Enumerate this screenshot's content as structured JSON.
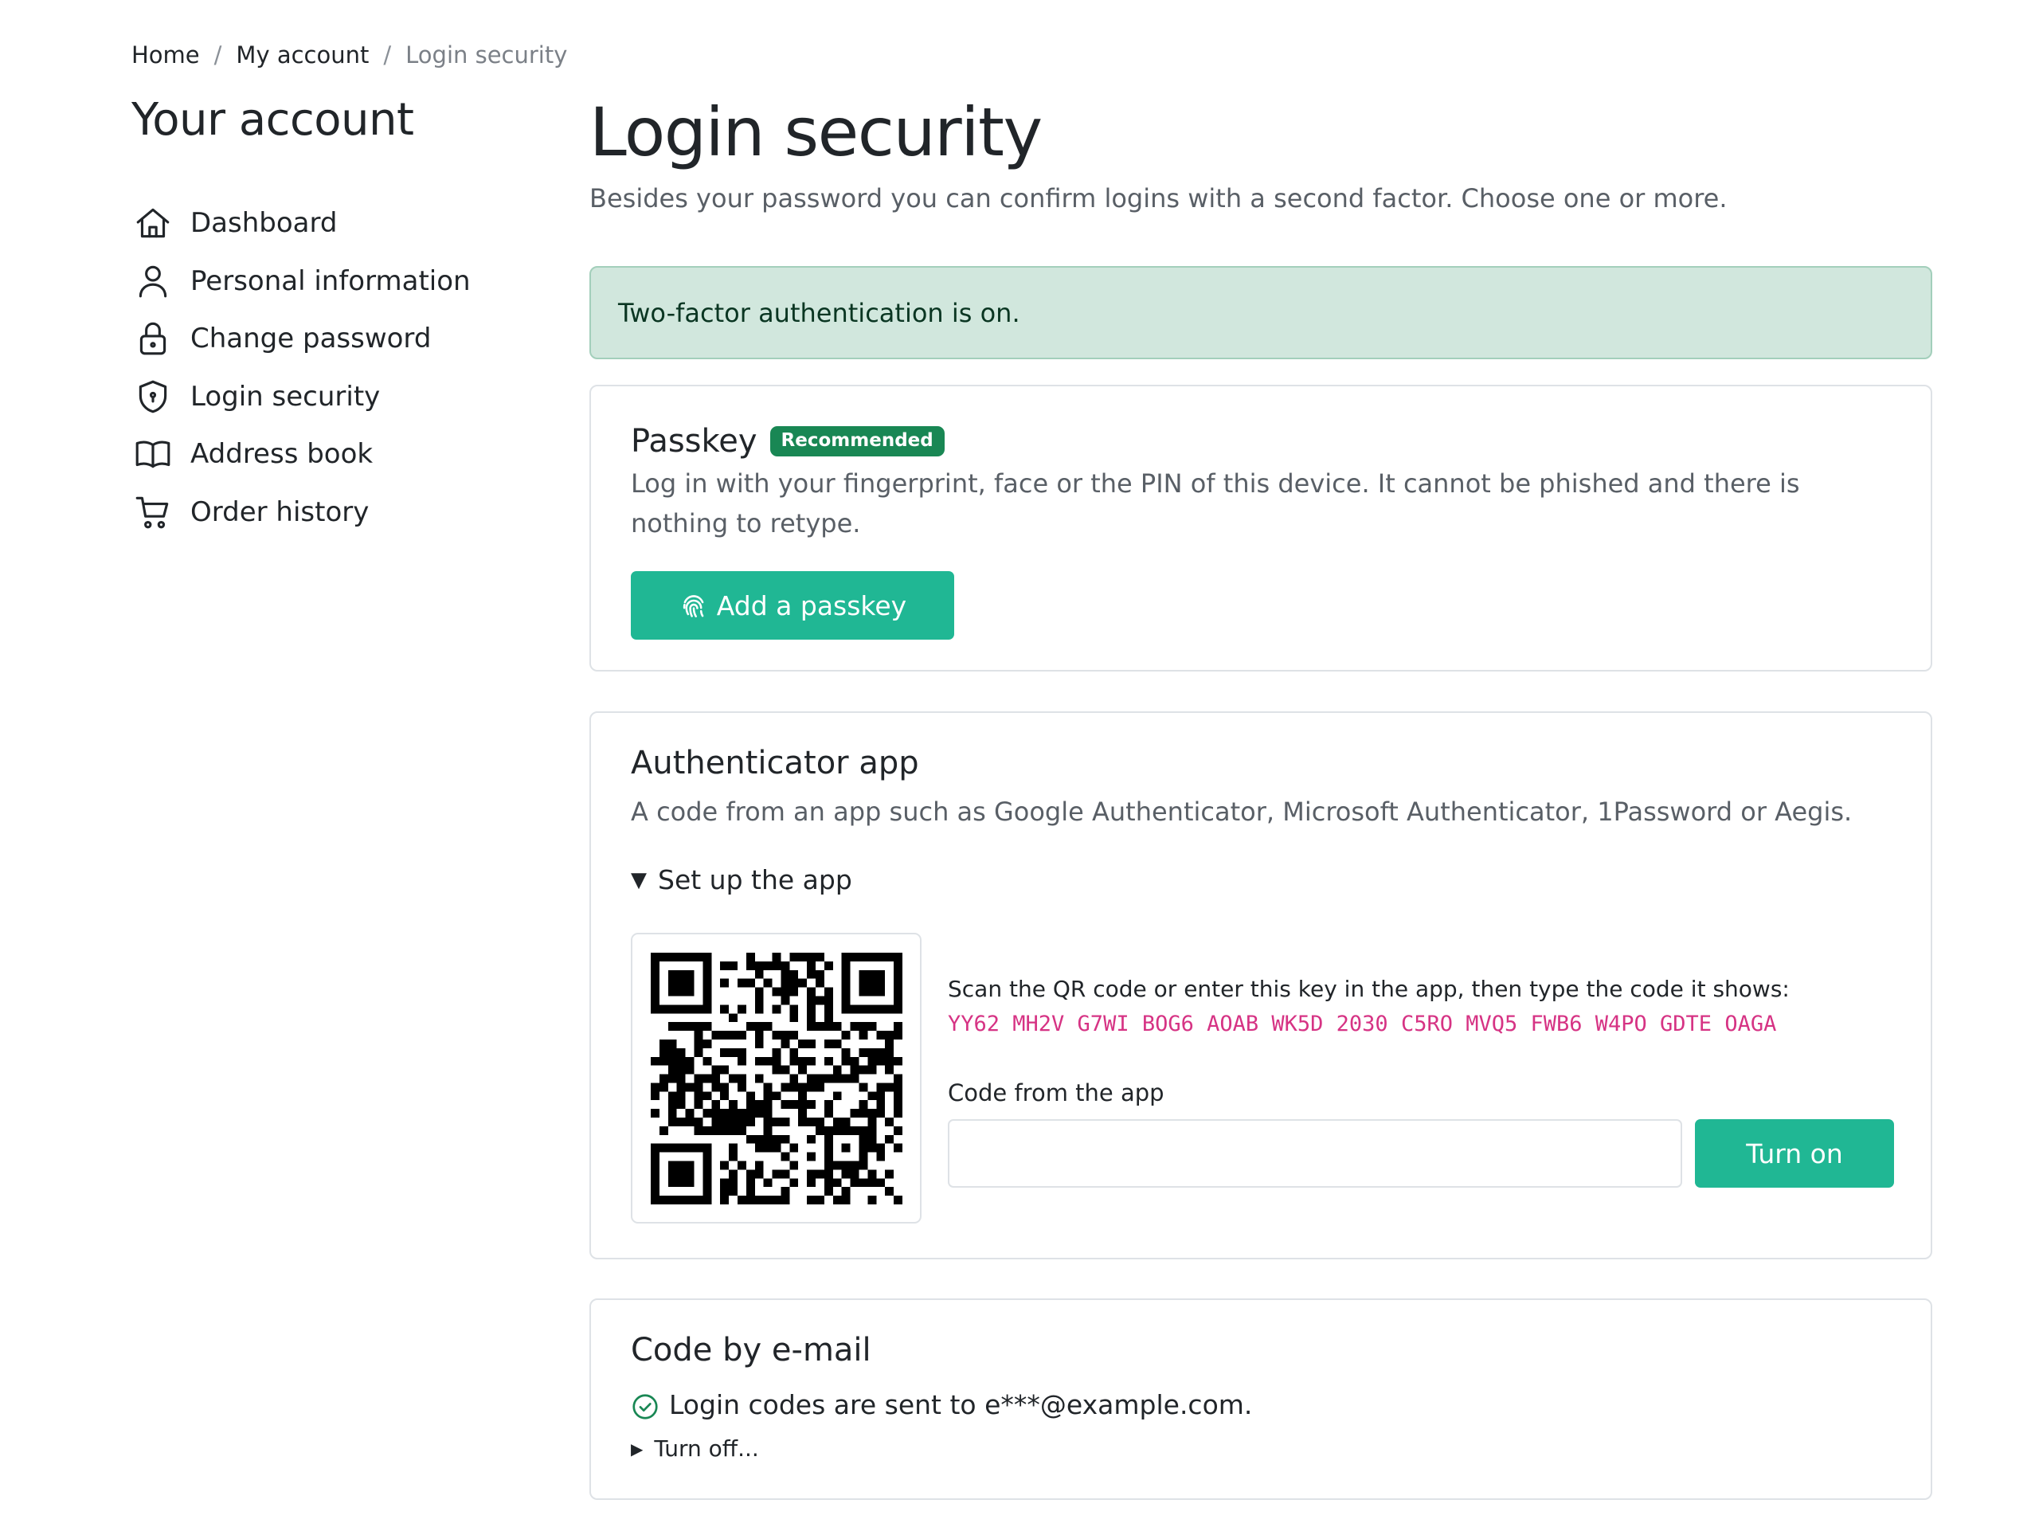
{
  "breadcrumb": {
    "home": "Home",
    "account": "My account",
    "current": "Login security",
    "separator": "/"
  },
  "sidebar": {
    "title": "Your account",
    "items": [
      {
        "label": "Dashboard",
        "icon": "home-icon"
      },
      {
        "label": "Personal information",
        "icon": "person-icon"
      },
      {
        "label": "Change password",
        "icon": "lock-icon"
      },
      {
        "label": "Login security",
        "icon": "shield-icon"
      },
      {
        "label": "Address book",
        "icon": "book-icon"
      },
      {
        "label": "Order history",
        "icon": "cart-icon"
      }
    ]
  },
  "main": {
    "title": "Login security",
    "lead": "Besides your password you can confirm logins with a second factor. Choose one or more.",
    "alert": "Two-factor authentication is on."
  },
  "passkey": {
    "title": "Passkey",
    "badge": "Recommended",
    "description": "Log in with your fingerprint, face or the PIN of this device. It cannot be phished and there is nothing to retype.",
    "button": "Add a passkey"
  },
  "authenticator": {
    "title": "Authenticator app",
    "description": "A code from an app such as Google Authenticator, Microsoft Authenticator, 1Password or Aegis.",
    "summary": "Set up the app",
    "summary_marker": "▼",
    "instructions": "Scan the QR code or enter this key in the app, then type the code it shows:",
    "key": "YY62 MH2V G7WI BOG6 AOAB WK5D 2030 C5RO MVQ5 FWB6 W4PO GDTE OAGA",
    "code_label": "Code from the app",
    "code_value": "",
    "button": "Turn on"
  },
  "email": {
    "title": "Code by e-mail",
    "status": "Login codes are sent to e***@example.com.",
    "turnoff": "Turn off...",
    "turnoff_marker": "▶"
  },
  "colors": {
    "accent": "#20b794",
    "success": "#198754",
    "alert_bg": "#d1e7dd",
    "key": "#d63384"
  }
}
